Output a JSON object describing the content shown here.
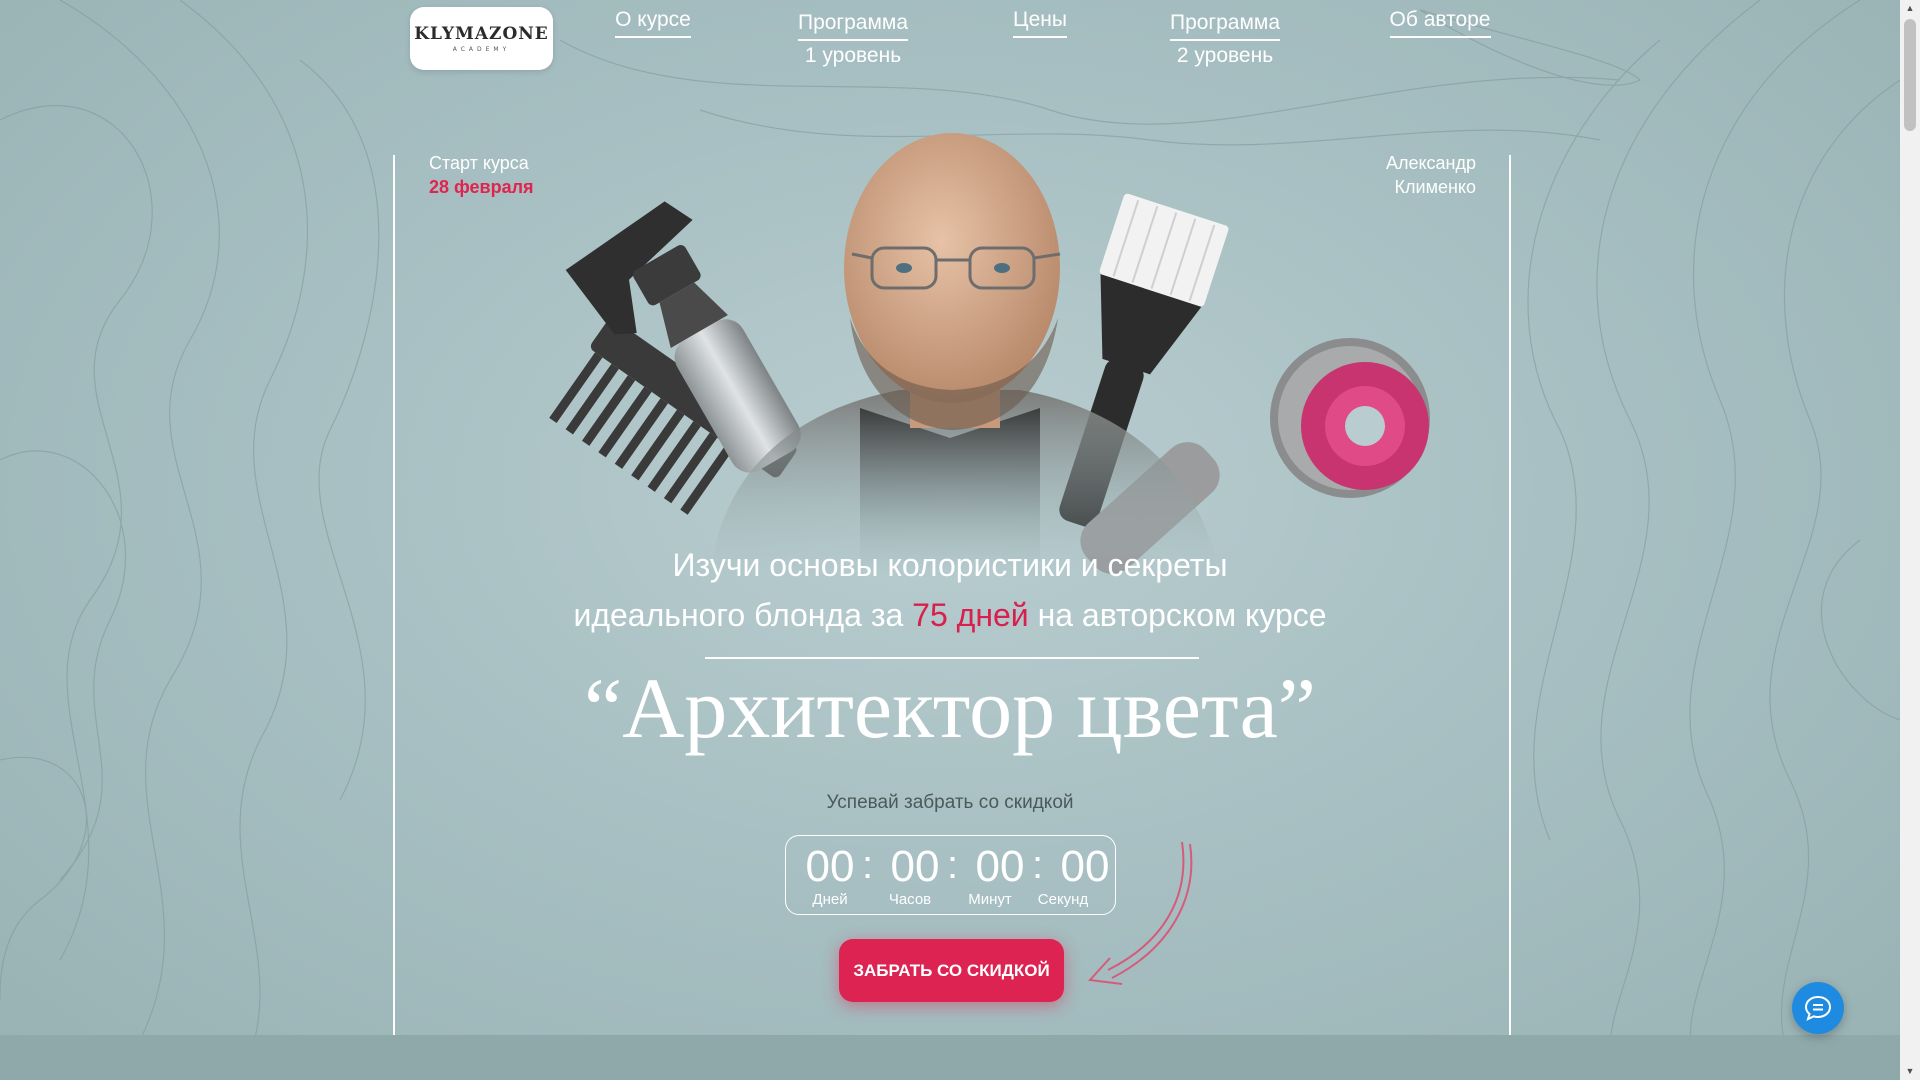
{
  "nav": {
    "logo_text": "KLYMAZONE",
    "logo_sub": "ACADEMY",
    "items": [
      {
        "line1": "О курсе",
        "line2": ""
      },
      {
        "line1": "Программа",
        "line2": "1 уровень"
      },
      {
        "line1": "Цены",
        "line2": ""
      },
      {
        "line1": "Программа",
        "line2": "2 уровень"
      },
      {
        "line1": "Об авторе",
        "line2": ""
      }
    ]
  },
  "hero": {
    "start_label": "Старт курса",
    "start_date": "28 февраля",
    "author_first": "Александр",
    "author_last": "Клименко",
    "headline_line1": "Изучи основы колористики и секреты",
    "headline_pre": "идеального блонда за ",
    "headline_accent": "75 дней",
    "headline_post": " на авторском курсе",
    "course_title": "“Архитектор цвета”",
    "hurry_text": "Успевай забрать со скидкой"
  },
  "timer": {
    "days": "00",
    "hours": "00",
    "minutes": "00",
    "seconds": "00",
    "sep": ":",
    "days_label": "Дней",
    "hours_label": "Часов",
    "minutes_label": "Минут",
    "seconds_label": "Секунд"
  },
  "cta": {
    "label": "ЗАБРАТЬ СО СКИДКОЙ"
  },
  "colors": {
    "accent": "#dd2351",
    "chat": "#1e8be0",
    "background": "#a8c0c3"
  },
  "icons": {
    "chat": "chat-bubble-icon",
    "arrow": "curved-arrow-icon"
  }
}
